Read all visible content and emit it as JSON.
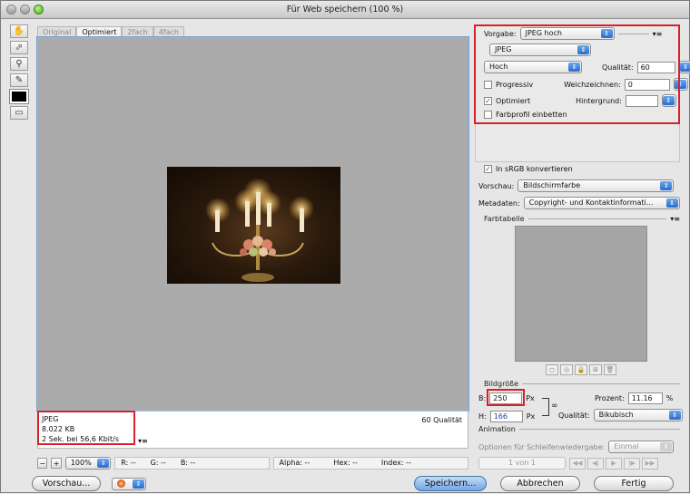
{
  "window": {
    "title": "Für Web speichern (100 %)"
  },
  "tabs": [
    "Original",
    "Optimiert",
    "2fach",
    "4fach"
  ],
  "info": {
    "format": "JPEG",
    "size": "8.022 KB",
    "time": "2 Sek. bei 56,6 Kbit/s",
    "quality": "60 Qualität",
    "menu_icon": "▾≡"
  },
  "statusbar": {
    "zoom": "100%",
    "r": "R: --",
    "g": "G: --",
    "b": "B: --",
    "alpha": "Alpha: --",
    "hex": "Hex: --",
    "index": "Index: --"
  },
  "bottom": {
    "preview_btn": "Vorschau...",
    "save_btn": "Speichern...",
    "cancel_btn": "Abbrechen",
    "done_btn": "Fertig"
  },
  "settings": {
    "preset_label": "Vorgabe:",
    "preset_value": "JPEG hoch",
    "format_value": "JPEG",
    "quality_level": "Hoch",
    "quality_label": "Qualität:",
    "quality_value": "60",
    "progressive_label": "Progressiv",
    "blur_label": "Weichzeichnen:",
    "blur_value": "0",
    "optimized_label": "Optimiert",
    "matte_label": "Hintergrund:",
    "embed_profile_label": "Farbprofil einbetten"
  },
  "conversion": {
    "srgb_label": "In sRGB konvertieren",
    "preview_label": "Vorschau:",
    "preview_value": "Bildschirmfarbe",
    "metadata_label": "Metadaten:",
    "metadata_value": "Copyright- und Kontaktinformati..."
  },
  "colortable": {
    "title": "Farbtabelle"
  },
  "imagesize": {
    "title": "Bildgröße",
    "w_label": "B:",
    "w_value": "250",
    "h_label": "H:",
    "h_value": "166",
    "unit": "Px",
    "percent_label": "Prozent:",
    "percent_value": "11.16",
    "percent_unit": "%",
    "quality_label": "Qualität:",
    "quality_value": "Bikubisch"
  },
  "animation": {
    "title": "Animation",
    "loop_label": "Optionen für Schleifenwiedergabe:",
    "loop_value": "Einmal",
    "frame": "1 von 1"
  }
}
